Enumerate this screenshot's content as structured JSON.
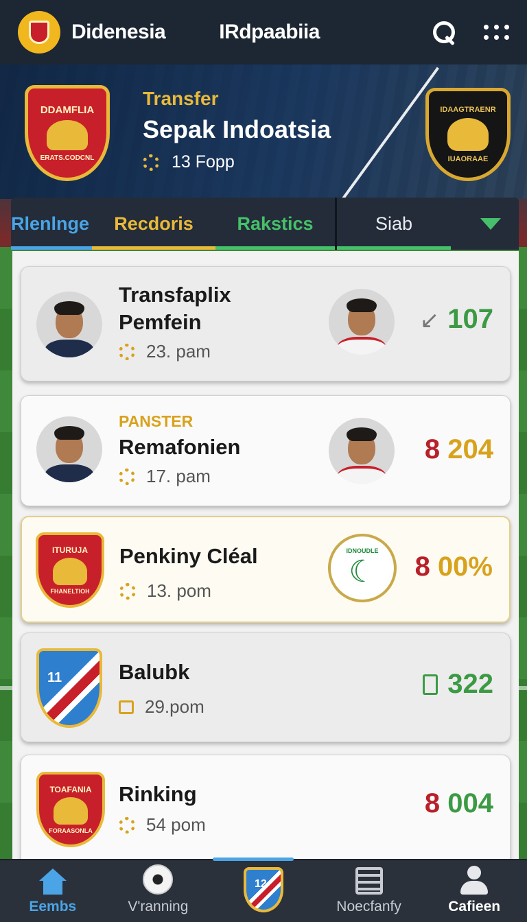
{
  "app": {
    "title": "Didenesia",
    "subtitle": "IRdpaabiia"
  },
  "hero": {
    "crest_left_text": "DDAMFLIA",
    "crest_left_bottom": "ERATS.CODCNL",
    "crest_right_text": "IDAAGTRAENR",
    "crest_right_bottom": "IUAORAAE",
    "kicker": "Transfer",
    "title": "Sepak Indoatsia",
    "meta": "13 Fopp"
  },
  "tabs": [
    "Rlenlnge",
    "Recdoris",
    "Rakstics",
    "Siab"
  ],
  "cards": [
    {
      "kicker": "",
      "title_line1": "Transfaplix",
      "title_line2": "Pemfein",
      "meta": "23. pam",
      "value": "107",
      "value_icon": "trend-icon",
      "value_color": "#3c9a44"
    },
    {
      "kicker": "PANSTER",
      "title_line1": "Remafonien",
      "title_line2": "",
      "meta": "17. pam",
      "value_a": "8",
      "value_b": "204",
      "value_color_a": "#b8202a",
      "value_color_b": "#d8a21c"
    },
    {
      "kicker": "",
      "title_line1": "Penkiny Cléal",
      "title_line2": "",
      "meta": "13. pom",
      "badge_left_text": "ITURUJA",
      "badge_left_bottom": "FHANELTIOH",
      "badge_right_text": "IDNOUDLE",
      "value_a": "8",
      "value_b": "00%",
      "value_color_a": "#b8202a",
      "value_color_b": "#d8a21c"
    },
    {
      "kicker": "",
      "title_line1": "Balubk",
      "title_line2": "",
      "meta": "29.pom",
      "badge_left_text": "11",
      "value": "322",
      "value_icon": "list-icon",
      "value_color": "#3c9a44"
    },
    {
      "kicker": "",
      "title_line1": "Rinking",
      "title_line2": "",
      "meta": "54  pom",
      "badge_left_text": "TOAFANIA",
      "badge_left_bottom": "FORAASONLA",
      "value_a": "8",
      "value_b": "004",
      "value_color_a": "#b8202a",
      "value_color_b": "#3c9a44"
    }
  ],
  "bottom_nav": [
    {
      "label": "Eembs",
      "icon": "home-icon",
      "active": true
    },
    {
      "label": "V'ranning",
      "icon": "ball-icon",
      "active": false
    },
    {
      "label": "",
      "icon": "center-badge-icon",
      "badge_text": "12",
      "active": false
    },
    {
      "label": "Noecfanfy",
      "icon": "news-icon",
      "active": false
    },
    {
      "label": "Cafieen",
      "icon": "profile-icon",
      "active": false
    }
  ]
}
